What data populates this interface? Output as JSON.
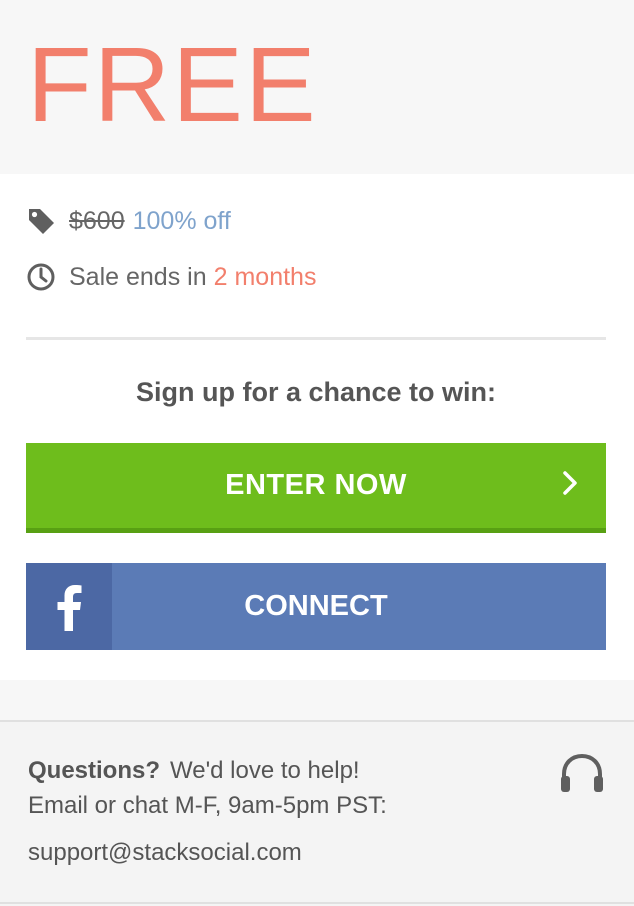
{
  "price": {
    "label": "FREE",
    "original": "$600",
    "discount": "100% off"
  },
  "sale": {
    "prefix": "Sale ends in",
    "time_left": "2 months"
  },
  "signup": {
    "heading": "Sign up for a chance to win:",
    "enter_label": "ENTER NOW",
    "connect_label": "CONNECT"
  },
  "help": {
    "questions": "Questions?",
    "love_to_help": "We'd love to help!",
    "hours": "Email or chat M-F, 9am-5pm PST:",
    "email": "support@stacksocial.com"
  },
  "icons": {
    "tag": "tag-icon",
    "clock": "clock-icon",
    "chevron": "chevron-right-icon",
    "facebook": "facebook-icon",
    "headphones": "headphones-icon"
  },
  "colors": {
    "accent_salmon": "#f27f6c",
    "discount_blue": "#7fa3cc",
    "enter_green": "#6ebd1c",
    "facebook_blue": "#5b7bb6",
    "facebook_dark": "#4c68a4"
  }
}
